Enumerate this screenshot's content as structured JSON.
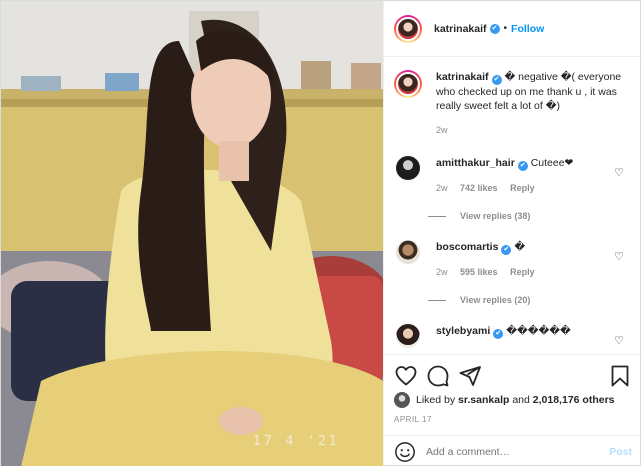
{
  "photo": {
    "date_stamp": "17 4 '21"
  },
  "header": {
    "username": "katrinakaif",
    "verified_mark": "✔",
    "separator": "•",
    "follow_label": "Follow"
  },
  "caption": {
    "username": "katrinakaif",
    "text": "� negative �( everyone who checked up on me thank u , it was really sweet felt a lot of �)",
    "time": "2w"
  },
  "comments": [
    {
      "username": "amitthakur_hair",
      "text": "Cuteee❤",
      "time": "2w",
      "likes": "742 likes",
      "reply": "Reply",
      "view_replies": "View replies (38)"
    },
    {
      "username": "boscomartis",
      "text": "�",
      "time": "2w",
      "likes": "595 likes",
      "reply": "Reply",
      "view_replies": "View replies (20)"
    },
    {
      "username": "stylebyami",
      "text": "������"
    }
  ],
  "actions": {
    "liked_by_prefix": "Liked by ",
    "liked_by_user": "sr.sankalp",
    "liked_by_and": " and ",
    "liked_by_count": "2,018,176 others",
    "date": "APRIL 17"
  },
  "add_comment": {
    "placeholder": "Add a comment…",
    "post_label": "Post"
  },
  "colors": {
    "accent": "#0095f6",
    "verified": "#3897f0",
    "muted": "#8e8e8e",
    "post_disabled": "#b2dffc"
  },
  "icons": [
    "heart-icon",
    "comment-icon",
    "share-icon",
    "bookmark-icon",
    "emoji-icon"
  ]
}
